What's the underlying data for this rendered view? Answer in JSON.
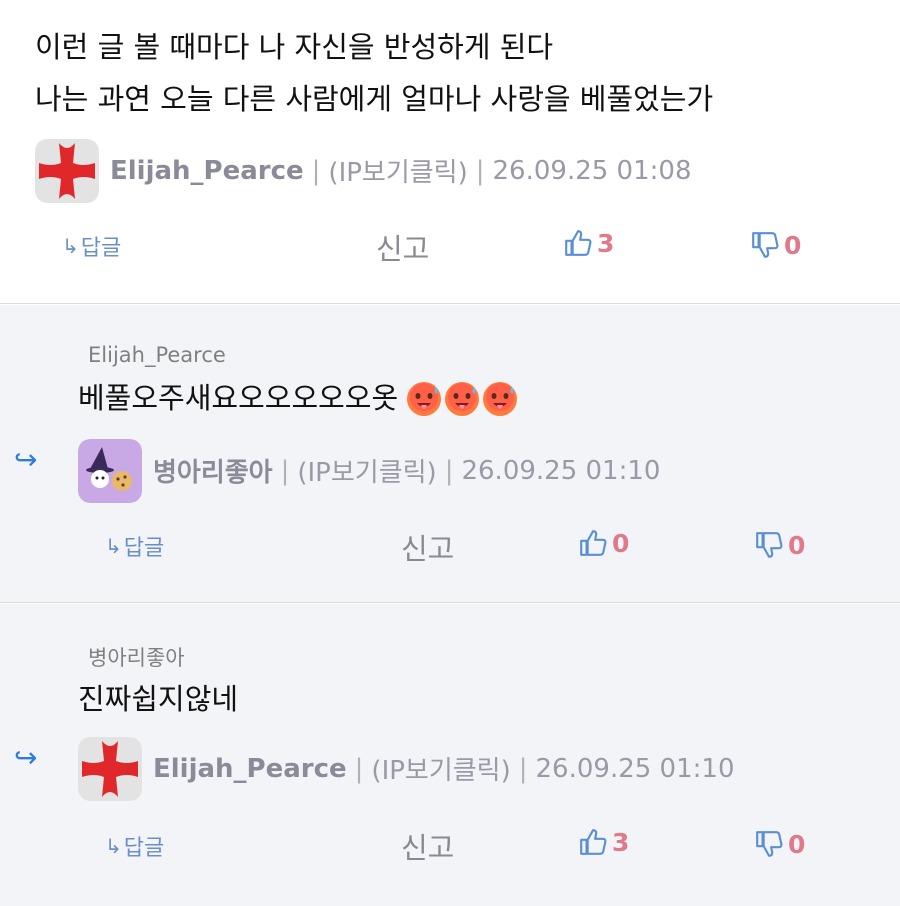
{
  "comments": [
    {
      "text_lines": [
        "이런 글 볼 때마다 나 자신을 반성하게 된다",
        "나는 과연 오늘 다른 사람에게 얼마나 사랑을 베풀었는가"
      ],
      "nickname": "Elijah_Pearce",
      "ip": "(IP보기클릭)",
      "timestamp": "26.09.25 01:08",
      "reply_label": "답글",
      "report_label": "신고",
      "likes": "3",
      "dislikes": "0",
      "avatar": "red-cross-avatar"
    },
    {
      "mention": "Elijah_Pearce",
      "text": "베풀오주새요오오오오오옷",
      "emojis": [
        "hot-face-emoji",
        "hot-face-emoji",
        "hot-face-emoji"
      ],
      "nickname": "병아리좋아",
      "ip": "(IP보기클릭)",
      "timestamp": "26.09.25 01:10",
      "reply_label": "답글",
      "report_label": "신고",
      "likes": "0",
      "dislikes": "0",
      "avatar": "purple-witch-avatar"
    },
    {
      "mention": "병아리좋아",
      "text": "진짜쉽지않네",
      "nickname": "Elijah_Pearce",
      "ip": "(IP보기클릭)",
      "timestamp": "26.09.25 01:10",
      "reply_label": "답글",
      "report_label": "신고",
      "likes": "3",
      "dislikes": "0",
      "avatar": "red-cross-avatar"
    }
  ],
  "colors": {
    "reply_bg": "#f3f4f8",
    "accent_blue": "#2f7be0",
    "vote_count": "#e07a8a",
    "cross_red": "#e0282a"
  }
}
